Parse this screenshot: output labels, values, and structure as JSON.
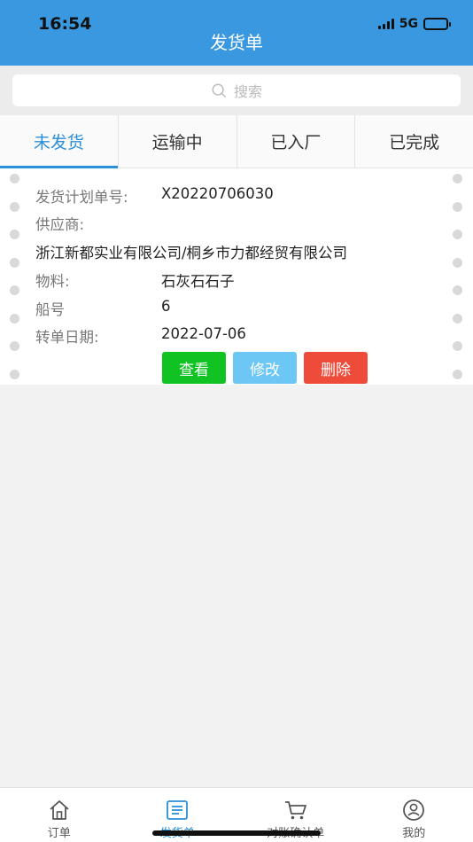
{
  "status_bar": {
    "time": "16:54",
    "network": "5G"
  },
  "header": {
    "title": "发货单"
  },
  "search": {
    "placeholder": "搜索"
  },
  "tabs": [
    {
      "label": "未发货",
      "active": true
    },
    {
      "label": "运输中",
      "active": false
    },
    {
      "label": "已入厂",
      "active": false
    },
    {
      "label": "已完成",
      "active": false
    }
  ],
  "card": {
    "plan_no_label": "发货计划单号:",
    "plan_no_value": "X20220706030",
    "supplier_label": "供应商:",
    "supplier_value": "浙江新都实业有限公司/桐乡市力都经贸有限公司",
    "material_label": "物料:",
    "material_value": "石灰石石子",
    "ship_label": "船号",
    "ship_value": "6",
    "date_label": "转单日期:",
    "date_value": "2022-07-06",
    "buttons": {
      "view": "查看",
      "edit": "修改",
      "delete": "删除"
    }
  },
  "bottom_nav": [
    {
      "label": "订单",
      "icon": "home-icon",
      "active": false
    },
    {
      "label": "发货单",
      "icon": "list-icon",
      "active": true
    },
    {
      "label": "对账确认单",
      "icon": "cart-icon",
      "active": false
    },
    {
      "label": "我的",
      "icon": "user-icon",
      "active": false
    }
  ],
  "colors": {
    "header": "#3a98e0",
    "accent": "#2a8fd8",
    "view": "#11c223",
    "edit": "#6cc7f5",
    "delete": "#ee4b3a"
  }
}
